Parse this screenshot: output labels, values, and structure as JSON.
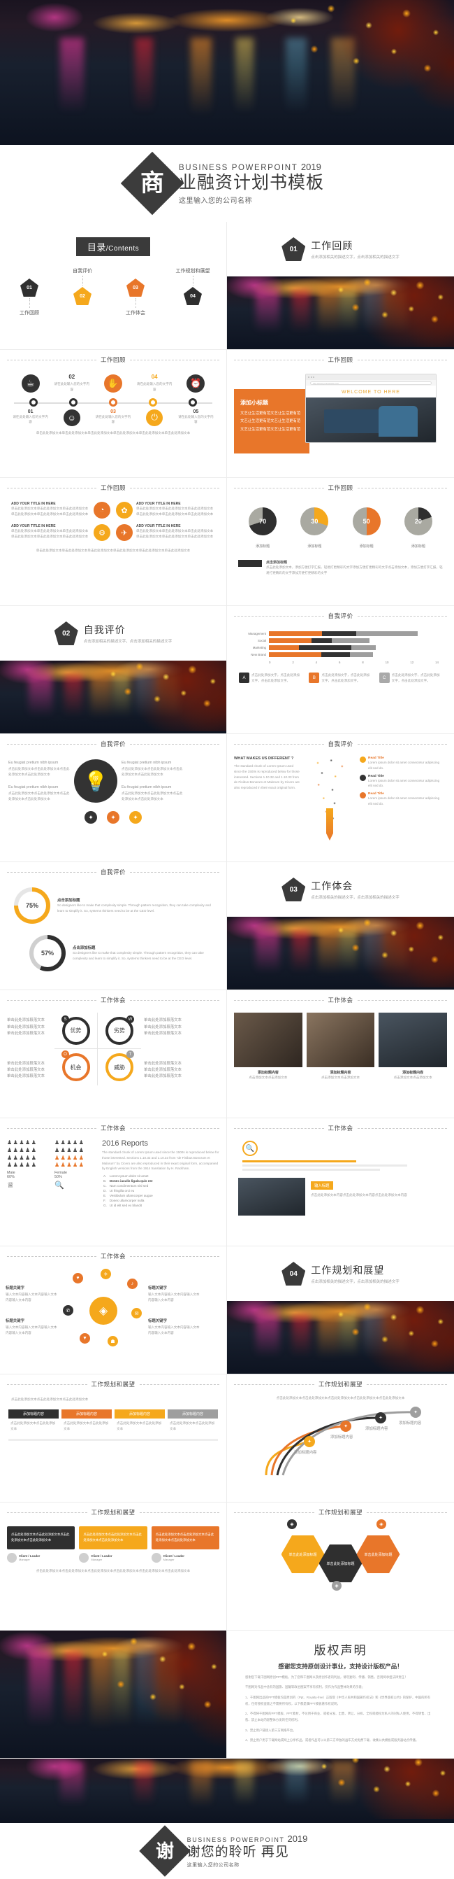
{
  "hero": {
    "alt": "city-night-lights-river-reflection-with-autumn-leaves"
  },
  "cover": {
    "mark": "商",
    "en_line": "BUSINESS POWERPOINT",
    "year": "2019",
    "title_cn": "业融资计划书模板",
    "company": "这里输入您的公司名称"
  },
  "toc": {
    "badge_cn": "目录",
    "badge_en": "/Contents",
    "items": [
      {
        "num": "01",
        "label": "工作回顾",
        "color": "#2f2f2f",
        "pos": "bottom"
      },
      {
        "num": "02",
        "label": "自我评价",
        "color": "#f5a81c",
        "pos": "top"
      },
      {
        "num": "03",
        "label": "工作体会",
        "color": "#e8762a",
        "pos": "bottom"
      },
      {
        "num": "04",
        "label": "工作规划和展望",
        "color": "#2f2f2f",
        "pos": "top"
      }
    ]
  },
  "sections": [
    {
      "num": "01",
      "title": "工作回顾",
      "sub": "点击添加相关的描述文字，点击添加相关的描述文字"
    },
    {
      "num": "02",
      "title": "自我评价",
      "sub": "点击添加相关的描述文字，点击添加相关的描述文字"
    },
    {
      "num": "03",
      "title": "工作体会",
      "sub": "点击添加相关的描述文字，点击添加相关的描述文字"
    },
    {
      "num": "04",
      "title": "工作规划和展望",
      "sub": "点击添加相关的描述文字，点击添加相关的描述文字"
    }
  ],
  "headers": {
    "h1": "工作回顾",
    "h2": "自我评价",
    "h3": "工作体会",
    "h4": "工作规划和展望"
  },
  "timeline": {
    "steps": [
      {
        "num": "01",
        "icon": "☕",
        "color": "#2f2f2f",
        "text": "请在此处输入您的文字内容"
      },
      {
        "num": "02",
        "icon": "☺",
        "color": "#2f2f2f",
        "text": "请在此处输入您的文字内容"
      },
      {
        "num": "03",
        "icon": "✋",
        "color": "#e8762a",
        "text": "请在此处输入您的文字内容"
      },
      {
        "num": "04",
        "icon": "⏻",
        "color": "#f5a81c",
        "text": "请在此处输入您的文字内容"
      },
      {
        "num": "05",
        "icon": "⏰",
        "color": "#2f2f2f",
        "text": "请在此处输入您的文字内容"
      }
    ]
  },
  "browser_slide": {
    "panel_title": "添加小标题",
    "panel_lines": [
      "文艺让生活更有范文艺让生活更有范",
      "文艺让生活更有范文艺让生活更有范",
      "文艺让生活更有范文艺让生活更有范"
    ],
    "browser_url": "http://www.yourwebsite.com",
    "welcome": "WELCOME TO HERE",
    "photo_alt": "person-typing-on-laptop-at-desk"
  },
  "four_box": {
    "boxes": [
      {
        "title": "ADD YOUR TITLE IN HERE",
        "icon": "◔",
        "color": "#e8762a"
      },
      {
        "title": "ADD YOUR TITLE IN HERE",
        "icon": "✿",
        "color": "#f5a81c"
      },
      {
        "title": "ADD YOUR TITLE IN HERE",
        "icon": "⚙",
        "color": "#f5a81c"
      },
      {
        "title": "ADD YOUR TITLE IN HERE",
        "icon": "✈",
        "color": "#e8762a"
      }
    ],
    "body": "单击此处添加文本单击此处添加文本单击此处添加文本单击此处添加文本单击此处添加文本单击此处添加文本"
  },
  "chart_data": [
    {
      "type": "pie",
      "title": "添加标题",
      "charts": [
        {
          "label": "添加标题",
          "value": 70,
          "fill": "#2f2f2f",
          "rest": "#a9a9a1"
        },
        {
          "label": "添加标题",
          "value": 30,
          "fill": "#f5a81c",
          "rest": "#a9a9a1"
        },
        {
          "label": "添加标题",
          "value": 50,
          "fill": "#e8762a",
          "rest": "#a9a9a1"
        },
        {
          "label": "添加标题",
          "value": 20,
          "fill": "#2f2f2f",
          "rest": "#a9a9a1"
        }
      ],
      "caption_title": "点击添加标题",
      "caption": "点击此处添加文本，添加方便打字汇报，轻易打更精彩的文字添加方便打更精彩的文字点击添加文本，添加方便打字汇报，轻易打更精彩的文字添加方便打更精彩的文字"
    },
    {
      "type": "bar",
      "orientation": "horizontal",
      "stacked": true,
      "title": "自我评价",
      "categories": [
        "Management",
        "Social",
        "Marketing",
        "New Brand"
      ],
      "series": [
        {
          "name": "B",
          "color": "#e8762a",
          "values": [
            4.4,
            3.5,
            2.5,
            4.3
          ]
        },
        {
          "name": "A",
          "color": "#2f2f2f",
          "values": [
            2.8,
            1.7,
            4.3,
            2.4
          ]
        },
        {
          "name": "C",
          "color": "#a9a9a9",
          "values": [
            5.1,
            3.1,
            2.0,
            1.9
          ]
        }
      ],
      "xlim": [
        0,
        14
      ],
      "xticks": [
        0,
        2,
        4,
        6,
        8,
        10,
        12,
        14
      ],
      "grid": true,
      "legend": [
        {
          "key": "A",
          "color": "#2f2f2f",
          "text": "点击此处添加文字，点击此处添加文字，点击此处添加文字。"
        },
        {
          "key": "B",
          "color": "#e8762a",
          "text": "点击此处添加文字，点击此处添加文字，点击此处添加文字。"
        },
        {
          "key": "C",
          "color": "#a9a9a9",
          "text": "点击此处添加文字，点击此处添加文字，点击此处添加文字。"
        }
      ]
    },
    {
      "type": "pie",
      "title": "自我评价",
      "subtype": "donut-progress",
      "charts": [
        {
          "label": "点击添加标题",
          "value": 75,
          "fill": "#f5a81c",
          "rest": "#e6e6e6",
          "text": "So designers like to make that complexity simple. Through pattern recognition, they can take complexity and learn to simplify it. So, systems thinkers need to be at the CEO level."
        },
        {
          "label": "点击添加标题",
          "value": 57,
          "fill": "#2f2f2f",
          "rest": "#cfcfcf",
          "text": "So designers like to make that complexity simple. Through pattern recognition, they can take complexity and learn to simplify it. So, systems thinkers need to be at the CEO level."
        }
      ]
    },
    {
      "type": "bar",
      "subtype": "pictogram",
      "title": "工作体会",
      "categories": [
        "Male",
        "Female"
      ],
      "values": [
        60,
        50
      ],
      "labels": [
        "60%",
        "50%"
      ],
      "icon_rows": 4,
      "icon_cols": 5,
      "colors": [
        "#4a4a4a",
        "#e8762a"
      ]
    }
  ],
  "bulb_slide": {
    "icon": "💡",
    "left": [
      "Eu feugiat pretium nibh ipsum",
      "Eu feugiat pretium nibh ipsum"
    ],
    "right": [
      "Eu feugiat pretium nibh ipsum",
      "Eu feugiat pretium nibh ipsum"
    ],
    "body": "点击此处添加文本点击此处添加文本点击此处添加文本点击此处添加文本"
  },
  "pencil_slide": {
    "heading": "WHAT MAKES US DIFFERENT ?",
    "body": "The standard chunk of Lorem Ipsum used since the 1500s is reproduced below for those interested. Sections 1.10.32 and 1.10.33 from de Finibus Bonorum et Malorum by Cicero are also reproduced in their exact original form.",
    "items": [
      {
        "title": "Read Title",
        "text": "Lorem ipsum dolor sit amet consectetur adipiscing elit sed do."
      },
      {
        "title": "Read Title",
        "text": "Lorem ipsum dolor sit amet consectetur adipiscing elit sed do."
      },
      {
        "title": "Read Title",
        "text": "Lorem ipsum dolor sit amet consectetur adipiscing elit sed do."
      }
    ]
  },
  "swot": {
    "quadrants": [
      {
        "key": "S",
        "label": "优势",
        "color": "#2f2f2f",
        "side": "left"
      },
      {
        "key": "W",
        "label": "劣势",
        "color": "#2f2f2f",
        "side": "right"
      },
      {
        "key": "O",
        "label": "机会",
        "color": "#e8762a",
        "side": "left"
      },
      {
        "key": "T",
        "label": "威胁",
        "color": "#f5a81c",
        "side": "right"
      }
    ],
    "note": "单击此处添加段落文本"
  },
  "photos3": {
    "items": [
      {
        "title": "添加标题内容",
        "sub": "点击添加文本点击添加文本",
        "alt": "interior-cafe-table"
      },
      {
        "title": "添加标题内容",
        "sub": "点击添加文本点击添加文本",
        "alt": "office-window"
      },
      {
        "title": "添加标题内容",
        "sub": "点击添加文本点击添加文本",
        "alt": "meeting-room"
      }
    ]
  },
  "reports": {
    "title": "2016 Reports",
    "body": "The standard chunk of Lorem Ipsum used since the 1500s is reproduced below for those interested. Sections 1.10.32 and 1.10.33 from \"de Finibus Bonorum et Malorum\" by Cicero are also reproduced in their exact original form, accompanied by English versions from the 1914 translation by H. Rackham.",
    "list": [
      {
        "k": "A.",
        "t": "Lorem Ipsum dolor sit amet"
      },
      {
        "k": "B.",
        "t": "Donec iaculis ligula quis est"
      },
      {
        "k": "C.",
        "t": "Nam condimentum nisl sed"
      },
      {
        "k": "D.",
        "t": "Ut fringilla orci eu"
      },
      {
        "k": "E.",
        "t": "Vestibulum ullamcorper augue"
      },
      {
        "k": "F.",
        "t": "Donec ullamcorper nulla"
      },
      {
        "k": "G.",
        "t": "Ut id elit sed ex blandit"
      }
    ],
    "right_title": "输入标题",
    "right_body": "点击此处添加文本内容点击此处添加文本内容点击此处添加文本内容",
    "photo_alt": "hands-on-keyboard"
  },
  "radial": {
    "center_icon": "◈",
    "nodes": [
      {
        "icon": "♥",
        "color": "#e8762a"
      },
      {
        "icon": "✈",
        "color": "#f5a81c"
      },
      {
        "icon": "♪",
        "color": "#e8762a"
      },
      {
        "icon": "✆",
        "color": "#2f2f2f"
      },
      {
        "icon": "✉",
        "color": "#f5a81c"
      },
      {
        "icon": "▼",
        "color": "#e8762a"
      },
      {
        "icon": "☗",
        "color": "#f5a81c"
      }
    ],
    "labels": [
      {
        "title": "标题关键字",
        "text": "输入文本内容输入文本内容输入文本内容输入文本内容"
      },
      {
        "title": "标题关键字",
        "text": "输入文本内容输入文本内容输入文本内容输入文本内容"
      },
      {
        "title": "标题关键字",
        "text": "输入文本内容输入文本内容输入文本内容输入文本内容"
      },
      {
        "title": "标题关键字",
        "text": "输入文本内容输入文本内容输入文本内容输入文本内容"
      }
    ]
  },
  "steps_slide": {
    "intro": "点击此处添加文本点击此处添加文本点击此处添加文本",
    "cards": [
      {
        "title": "添加标题内容",
        "color": "#2f2f2f",
        "text": "点击此处添加文本点击此处添加文本"
      },
      {
        "title": "添加标题内容",
        "color": "#e8762a",
        "text": "点击此处添加文本点击此处添加文本"
      },
      {
        "title": "添加标题内容",
        "color": "#f5a81c",
        "text": "点击此处添加文本点击此处添加文本"
      },
      {
        "title": "添加标题内容",
        "color": "#9e9e9e",
        "text": "点击此处添加文本点击此处添加文本"
      }
    ]
  },
  "tree_slide": {
    "nodes": [
      {
        "title": "添加标题内容",
        "color": "#f5a81c"
      },
      {
        "title": "添加标题内容",
        "color": "#e8762a"
      },
      {
        "title": "添加标题内容",
        "color": "#2f2f2f"
      },
      {
        "title": "添加标题内容",
        "color": "#9e9e9e"
      }
    ],
    "body": "点击此处添加文本点击此处添加文本点击此处添加文本点击此处添加文本点击此处添加文本"
  },
  "quotes": {
    "cards": [
      {
        "color": "#2f2f2f",
        "text": "点击此处添加文本点击此处添加文本点击此处添加文本点击此处添加文本",
        "name": "Client / Leader",
        "role": "Manager"
      },
      {
        "color": "#f5a81c",
        "text": "点击此处添加文本点击此处添加文本点击此处添加文本点击此处添加文本",
        "name": "Client / Leader",
        "role": "Manager"
      },
      {
        "color": "#e8762a",
        "text": "点击此处添加文本点击此处添加文本点击此处添加文本点击此处添加文本",
        "name": "Client / Leader",
        "role": "Manager"
      }
    ],
    "footer": "点击此处添加文本点击此处添加文本点击此处添加文本点击此处添加文本点击此处添加文本点击此处添加文本"
  },
  "hexagons": {
    "items": [
      {
        "title": "单击此处添加标题",
        "color": "#f5a81c"
      },
      {
        "title": "单击此处添加标题",
        "color": "#2f2f2f"
      },
      {
        "title": "单击此处添加标题",
        "color": "#e8762a"
      }
    ]
  },
  "copyright": {
    "title": "版权声明",
    "subtitle": "感谢您支持原创设计事业，支持设计版权产品！",
    "paragraphs": [
      "感谢您下载千图网原创PPT模板，为了您和千图网以及原创作者的利益，请勿复制、传播、销售，否则将承担法律责任！",
      "千图网对作品中含有的国旗、国徽等政治图案不享有权利，仅作为作品整体效果的示意；",
      "1、千图网出品的PPT模板均是原创的（Ppt、Royalty-free）正版受《中华人民共和国著作权法》和《世界版权公约》的保护，中国的所有权，任何侵权盗版之不需要所有权，以下都是属PPT模板著作权说明。",
      "2、不得将千图网的PPT模板、PPT素材，不论用于商业、或者分发、出售、转让、分拆、全权或授权为私人的对私人使用，不得转售、出售、禁止本站内容整体分发的任何权利。",
      "3、禁止用户链接入第三方网络平台。",
      "4、禁止用户用于下载网站或网上分享作品，或者作品可以以第三方单独的画布方式免费下载、收集公共模板或服务器站点传播。"
    ]
  },
  "closing": {
    "mark": "谢",
    "en_line": "BUSINESS POWERPOINT",
    "year": "2019",
    "title_cn": "谢您的聆听  再见",
    "company": "这里输入您的公司名称"
  }
}
